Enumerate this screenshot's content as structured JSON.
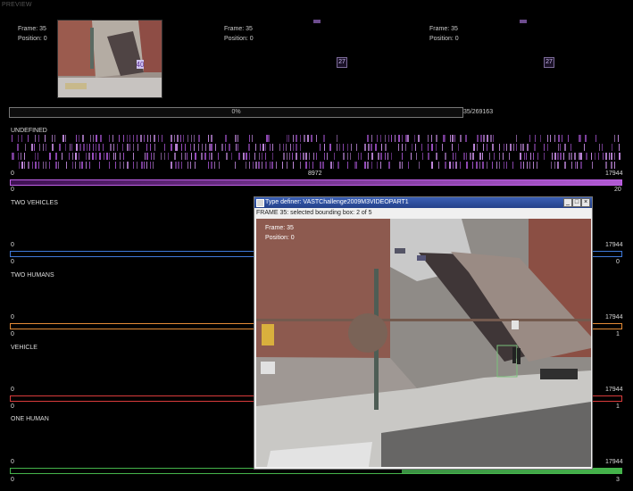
{
  "preview": {
    "title": "PREVIEW",
    "frames": [
      {
        "frame": "Frame: 35",
        "position": "Position: 0"
      },
      {
        "frame": "Frame: 35",
        "position": "Position: 0"
      },
      {
        "frame": "Frame: 35",
        "position": "Position: 0"
      }
    ],
    "thumb_tags": [
      "27",
      "27"
    ]
  },
  "progress": {
    "percent_label": "0%",
    "count": "35/269163"
  },
  "categories": [
    {
      "name": "UNDEFINED",
      "tick_low": "0",
      "tick_mid": "8972",
      "tick_high": "17944",
      "scale_low": "0",
      "scale_high": "20",
      "color": "#b25ad8"
    },
    {
      "name": "TWO VEHICLES",
      "tick_low": "0",
      "tick_high": "17944",
      "scale_low": "0",
      "scale_high": "0",
      "color": "#3f79d9"
    },
    {
      "name": "TWO HUMANS",
      "tick_low": "0",
      "tick_high": "17944",
      "scale_low": "0",
      "scale_high": "1",
      "color": "#e58b36"
    },
    {
      "name": "VEHICLE",
      "tick_low": "0",
      "tick_high": "17944",
      "scale_low": "0",
      "scale_high": "1",
      "color": "#d93b3b"
    },
    {
      "name": "ONE HUMAN",
      "tick_low": "0",
      "tick_high": "17944",
      "scale_low": "0",
      "scale_high": "3",
      "color": "#45b44b"
    }
  ],
  "dialog": {
    "title": "Type definer: VASTChallenge2009M3VIDEOPART1",
    "status": "FRAME 35: selected bounding box: 2 of 5",
    "overlay_frame": "Frame: 35",
    "overlay_position": "Position: 0",
    "buttons": [
      "_",
      "□",
      "×"
    ]
  }
}
